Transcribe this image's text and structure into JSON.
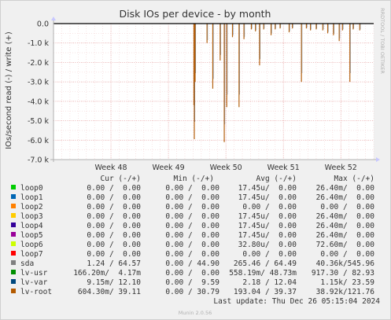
{
  "chart_data": {
    "type": "line",
    "title": "Disk IOs per device - by month",
    "ylabel": "IOs/second read (-) / write (+)",
    "side_label": "RRDTOOL / TOBI OETIKER",
    "ylim": [
      -7000,
      0
    ],
    "yticks": [
      {
        "value": 0,
        "label": "0.0"
      },
      {
        "value": -1000,
        "label": "-1.0 k"
      },
      {
        "value": -2000,
        "label": "-2.0 k"
      },
      {
        "value": -3000,
        "label": "-3.0 k"
      },
      {
        "value": -4000,
        "label": "-4.0 k"
      },
      {
        "value": -5000,
        "label": "-5.0 k"
      },
      {
        "value": -6000,
        "label": "-6.0 k"
      },
      {
        "value": -7000,
        "label": "-7.0 k"
      }
    ],
    "xlim_days": [
      0,
      39
    ],
    "xticks": [
      {
        "day": 7,
        "label": "Week 48"
      },
      {
        "day": 14,
        "label": "Week 49"
      },
      {
        "day": 21,
        "label": "Week 50"
      },
      {
        "day": 28,
        "label": "Week 51"
      },
      {
        "day": 35,
        "label": "Week 52"
      }
    ],
    "grid": true,
    "series_spikes": [
      {
        "day": 17.1,
        "value": -4200
      },
      {
        "day": 17.15,
        "value": -5950
      },
      {
        "day": 17.25,
        "value": -3000
      },
      {
        "day": 18.7,
        "value": -1000
      },
      {
        "day": 19.4,
        "value": -3350
      },
      {
        "day": 20.3,
        "value": -1900
      },
      {
        "day": 20.8,
        "value": -6100
      },
      {
        "day": 21.1,
        "value": -4300
      },
      {
        "day": 21.8,
        "value": -700
      },
      {
        "day": 22.6,
        "value": -4300
      },
      {
        "day": 23.2,
        "value": -800
      },
      {
        "day": 24.1,
        "value": -300
      },
      {
        "day": 24.6,
        "value": -400
      },
      {
        "day": 25.1,
        "value": -2150
      },
      {
        "day": 25.6,
        "value": -300
      },
      {
        "day": 26.5,
        "value": -600
      },
      {
        "day": 27.0,
        "value": -300
      },
      {
        "day": 27.6,
        "value": -250
      },
      {
        "day": 28.7,
        "value": -450
      },
      {
        "day": 29.1,
        "value": -250
      },
      {
        "day": 30.2,
        "value": -3000
      },
      {
        "day": 30.8,
        "value": -250
      },
      {
        "day": 31.3,
        "value": -350
      },
      {
        "day": 32.0,
        "value": -300
      },
      {
        "day": 32.8,
        "value": -350
      },
      {
        "day": 33.4,
        "value": -500
      },
      {
        "day": 34.1,
        "value": -600
      },
      {
        "day": 34.8,
        "value": -900
      },
      {
        "day": 35.2,
        "value": -350
      },
      {
        "day": 36.1,
        "value": -3000
      },
      {
        "day": 36.5,
        "value": -300
      },
      {
        "day": 37.3,
        "value": -350
      }
    ],
    "series_color": "#b4610f"
  },
  "legend": {
    "headers": {
      "cur": "Cur (-/+)",
      "min": "Min (-/+)",
      "avg": "Avg (-/+)",
      "max": "Max (-/+)"
    },
    "rows": [
      {
        "name": "loop0",
        "color": "#00cc00",
        "cur": "0.00 /  0.00",
        "min": "0.00 /  0.00",
        "avg": "17.45u/  0.00",
        "max": "26.40m/  0.00"
      },
      {
        "name": "loop1",
        "color": "#0066b3",
        "cur": "0.00 /  0.00",
        "min": "0.00 /  0.00",
        "avg": "17.45u/  0.00",
        "max": "26.40m/  0.00"
      },
      {
        "name": "loop2",
        "color": "#ff8000",
        "cur": "0.00 /  0.00",
        "min": "0.00 /  0.00",
        "avg": "0.00 /  0.00",
        "max": "0.00 /  0.00"
      },
      {
        "name": "loop3",
        "color": "#ffcc00",
        "cur": "0.00 /  0.00",
        "min": "0.00 /  0.00",
        "avg": "17.45u/  0.00",
        "max": "26.40m/  0.00"
      },
      {
        "name": "loop4",
        "color": "#330099",
        "cur": "0.00 /  0.00",
        "min": "0.00 /  0.00",
        "avg": "17.45u/  0.00",
        "max": "26.40m/  0.00"
      },
      {
        "name": "loop5",
        "color": "#990099",
        "cur": "0.00 /  0.00",
        "min": "0.00 /  0.00",
        "avg": "17.45u/  0.00",
        "max": "26.40m/  0.00"
      },
      {
        "name": "loop6",
        "color": "#ccff00",
        "cur": "0.00 /  0.00",
        "min": "0.00 /  0.00",
        "avg": "32.80u/  0.00",
        "max": "72.60m/  0.00"
      },
      {
        "name": "loop7",
        "color": "#ff0000",
        "cur": "0.00 /  0.00",
        "min": "0.00 /  0.00",
        "avg": "0.00 /  0.00",
        "max": "0.00 /  0.00"
      },
      {
        "name": "sda",
        "color": "#808080",
        "cur": "1.24 / 64.57",
        "min": "0.00 / 44.90",
        "avg": "265.46 / 64.49",
        "max": "40.36k/545.96"
      },
      {
        "name": "lv-usr",
        "color": "#008f00",
        "cur": "166.20m/  4.17m",
        "min": "0.00 /  0.00",
        "avg": "558.19m/ 48.73m",
        "max": "917.30 / 82.93"
      },
      {
        "name": "lv-var",
        "color": "#00487d",
        "cur": "9.15m/ 12.10",
        "min": "0.00 /  9.59",
        "avg": "2.18 / 12.04",
        "max": "1.15k/ 23.59"
      },
      {
        "name": "lv-root",
        "color": "#b35a00",
        "cur": "604.30m/ 39.11",
        "min": "0.00 / 30.79",
        "avg": "193.04 / 39.37",
        "max": "38.92k/121.76"
      }
    ]
  },
  "last_update": "Last update: Thu Dec 26 05:15:04 2024",
  "footer": "Munin 2.0.56"
}
